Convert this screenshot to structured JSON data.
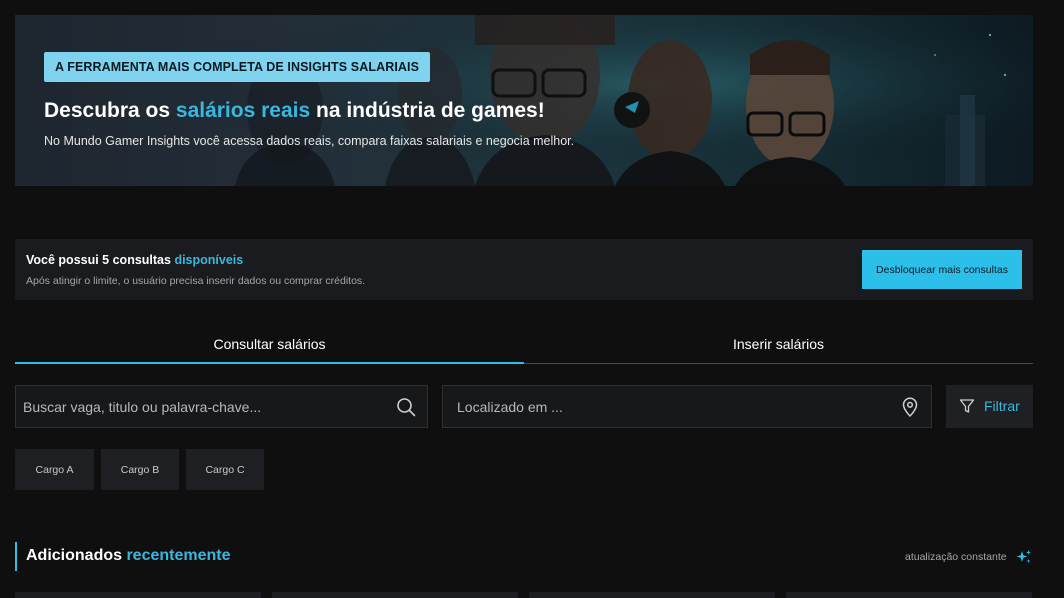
{
  "hero": {
    "badge": "A FERRAMENTA MAIS COMPLETA DE INSIGHTS SALARIAIS",
    "title_pre": "Descubra os ",
    "title_accent": "salários reais",
    "title_post": " na indústria de games!",
    "subtitle": "No Mundo Gamer Insights você acessa dados reais, compara faixas salariais e negocia melhor."
  },
  "credits": {
    "title_pre": "Você possui 5 consultas ",
    "title_accent": "disponíveis",
    "subtitle": "Após atingir o limite, o usuário precisa inserir dados ou comprar créditos.",
    "unlock_label": "Desbloquear mais consultas"
  },
  "tabs": [
    {
      "label": "Consultar salários",
      "active": true
    },
    {
      "label": "Inserir salários",
      "active": false
    }
  ],
  "search": {
    "placeholder": "Buscar vaga, titulo ou palavra-chave...",
    "location_placeholder": "Localizado em ...",
    "filter_label": "Filtrar"
  },
  "chips": [
    "Cargo A",
    "Cargo B",
    "Cargo C"
  ],
  "recent": {
    "title_pre": "Adicionados ",
    "title_accent": "recentemente",
    "update_label": "atualização constante"
  },
  "colors": {
    "accent": "#2bbfea",
    "background": "#0f0f10",
    "panel": "#1a1b1e"
  }
}
